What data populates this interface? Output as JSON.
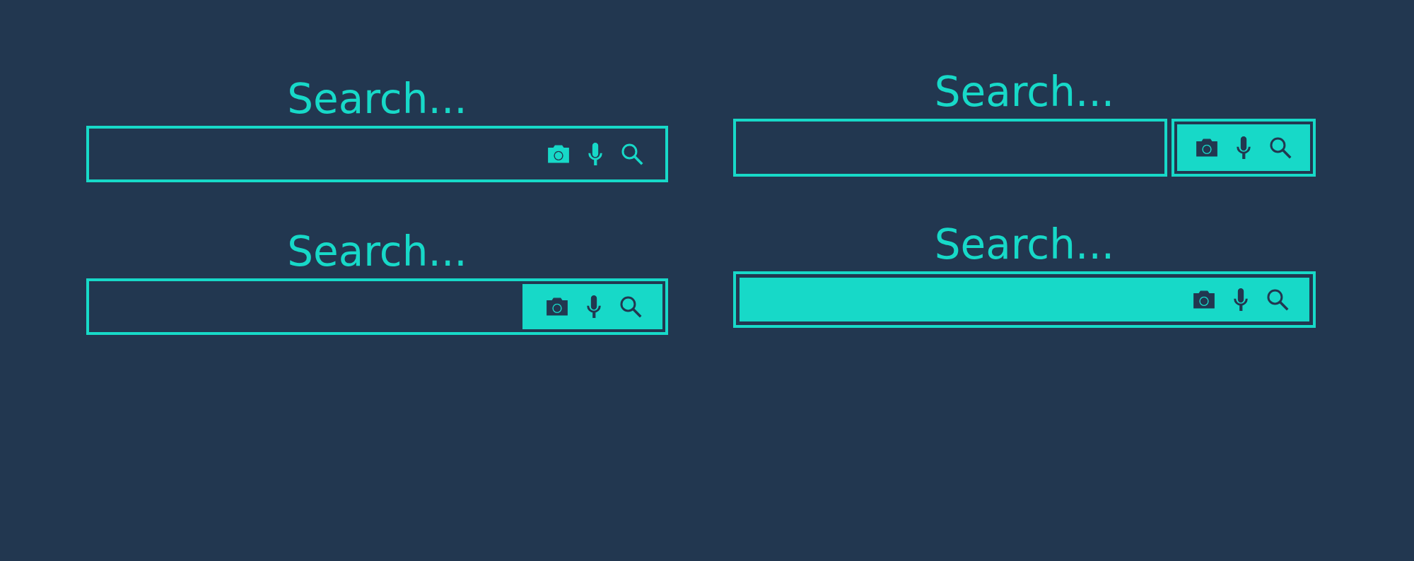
{
  "search_bars": [
    {
      "label": "Search...",
      "kind": "outline"
    },
    {
      "label": "Search...",
      "kind": "split"
    },
    {
      "label": "Search...",
      "kind": "inset"
    },
    {
      "label": "Search...",
      "kind": "filled"
    }
  ]
}
